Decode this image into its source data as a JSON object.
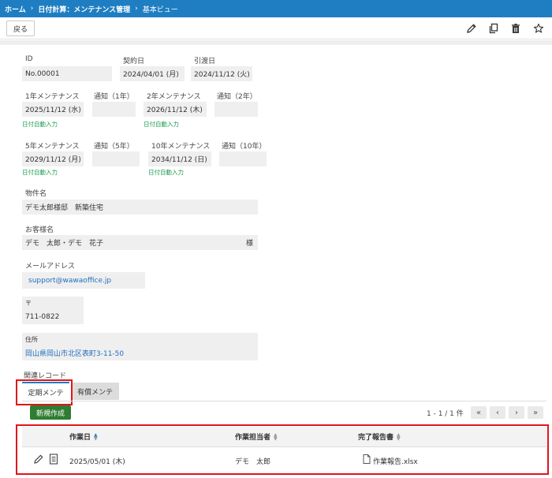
{
  "breadcrumb": {
    "home": "ホーム",
    "sep": "›",
    "app": "日付計算：メンテナンス管理",
    "view": "基本ビュー"
  },
  "toolbar": {
    "back_label": "戻る",
    "icons": [
      "pencil-icon",
      "copy-icon",
      "trash-icon",
      "star-icon"
    ]
  },
  "record": {
    "id_label": "ID",
    "id_value": "No.00001",
    "contract_label": "契約日",
    "contract_value": "2024/04/01 (月)",
    "delivery_label": "引渡日",
    "delivery_value": "2024/11/12 (火)",
    "m1_label": "1年メンテナンス",
    "m1_value": "2025/11/12 (水)",
    "m1_auto": "日付自動入力",
    "n1_label": "通知（1年）",
    "m2_label": "2年メンテナンス",
    "m2_value": "2026/11/12 (木)",
    "m2_auto": "日付自動入力",
    "n2_label": "通知（2年）",
    "m5_label": "5年メンテナンス",
    "m5_value": "2029/11/12 (月)",
    "m5_auto": "日付自動入力",
    "n5_label": "通知（5年）",
    "m10_label": "10年メンテナンス",
    "m10_value": "2034/11/12 (日)",
    "m10_auto": "日付自動入力",
    "n10_label": "通知（10年）",
    "property_label": "物件名",
    "property_value": "デモ太郎様邸　新築住宅",
    "customer_label": "お客様名",
    "customer_value": "デモ　太郎・デモ　花子",
    "customer_suffix": "様",
    "email_label": "メールアドレス",
    "email_value": "support@wawaoffice.jp",
    "zip_label": "〒",
    "zip_value": "711-0822",
    "address_label": "住所",
    "address_value": "岡山県岡山市北区表町3-11-50"
  },
  "related": {
    "label": "関連レコード",
    "tabs": [
      {
        "label": "定期メンテ",
        "active": true
      },
      {
        "label": "有償メンテ",
        "active": false
      }
    ],
    "new_button": "新規作成",
    "pager_text": "1 - 1 / 1 件",
    "pager_icons": [
      "first-page-icon",
      "prev-page-icon",
      "next-page-icon",
      "last-page-icon"
    ],
    "table": {
      "columns": [
        "作業日",
        "作業担当者",
        "完了報告書"
      ],
      "rows": [
        {
          "date": "2025/05/01 (木)",
          "staff": "デモ　太郎",
          "report": "作業報告.xlsx"
        }
      ]
    }
  },
  "colors": {
    "header": "#1f7ec2",
    "highlight": "#e2141b",
    "new_button": "#2f7d32",
    "link": "#1f6fbf",
    "auto_text": "#1a9a4a"
  }
}
